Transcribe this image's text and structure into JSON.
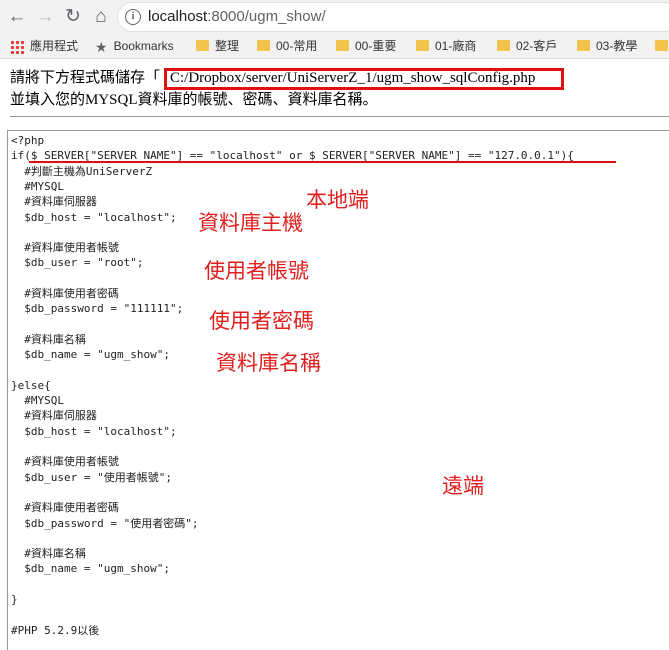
{
  "browser": {
    "url_host": "localhost",
    "url_rest": ":8000/ugm_show/"
  },
  "bookmarks": [
    {
      "label": "應用程式",
      "icon": "apps-icon"
    },
    {
      "label": "Bookmarks",
      "icon": "star-icon"
    },
    {
      "label": "整理",
      "icon": "folder-icon"
    },
    {
      "label": "00-常用",
      "icon": "folder-icon"
    },
    {
      "label": "00-重要",
      "icon": "folder-icon"
    },
    {
      "label": "01-廠商",
      "icon": "folder-icon"
    },
    {
      "label": "02-客戶",
      "icon": "folder-icon"
    },
    {
      "label": "03-教學",
      "icon": "folder-icon"
    }
  ],
  "instruction": {
    "prefix": "請將下方程式碼儲存「",
    "path": "C:/Dropbox/server/UniServerZ_1/ugm_show_sqlConfig.php",
    "line2": "並填入您的MYSQL資料庫的帳號、密碼、資料庫名稱。"
  },
  "code_lines": [
    "<?php",
    "if($_SERVER[\"SERVER_NAME\"] == \"localhost\" or $_SERVER[\"SERVER_NAME\"] == \"127.0.0.1\"){",
    "  #判斷主機為UniServerZ",
    "  #MYSQL",
    "  #資料庫伺服器",
    "  $db_host = \"localhost\";",
    "",
    "  #資料庫使用者帳號",
    "  $db_user = \"root\";",
    "",
    "  #資料庫使用者密碼",
    "  $db_password = \"111111\";",
    "",
    "  #資料庫名稱",
    "  $db_name = \"ugm_show\";",
    "",
    "}else{",
    "  #MYSQL",
    "  #資料庫伺服器",
    "  $db_host = \"localhost\";",
    "",
    "  #資料庫使用者帳號",
    "  $db_user = \"使用者帳號\";",
    "",
    "  #資料庫使用者密碼",
    "  $db_password = \"使用者密碼\";",
    "",
    "  #資料庫名稱",
    "  $db_name = \"ugm_show\";",
    "",
    "}",
    "",
    "#PHP 5.2.9以後"
  ],
  "annotations": {
    "local": "本地端",
    "db_host": "資料庫主機",
    "db_user": "使用者帳號",
    "db_password": "使用者密碼",
    "db_name": "資料庫名稱",
    "remote": "遠端"
  },
  "colors": {
    "annotation": "#e0201e",
    "highlight_box": "#e01010"
  }
}
